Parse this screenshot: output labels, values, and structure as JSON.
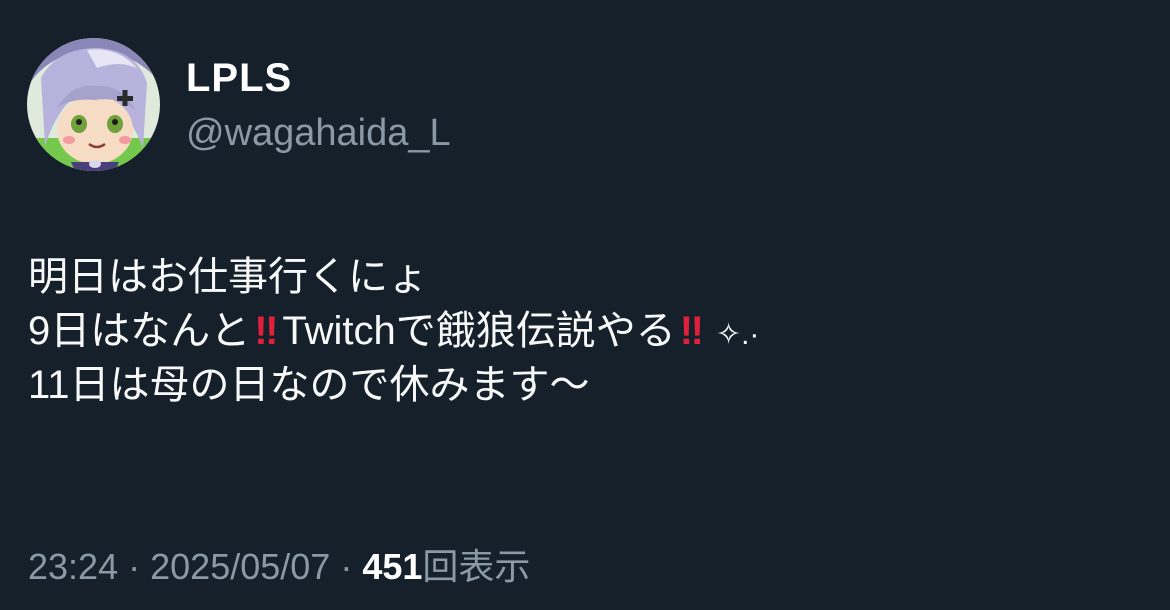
{
  "author": {
    "display_name": "LPLS",
    "handle": "@wagahaida_L",
    "avatar_icon": "anime-character-avatar"
  },
  "post": {
    "line1": "明日はお仕事行くにょ",
    "line2_prefix": "9日はなんと",
    "line2_middle": "Twitchで餓狼伝説やる",
    "emphasis": "‼",
    "emphasis_color": "#e0203a",
    "sparkle": "✧.·",
    "line3": "11日は母の日なので休みます〜"
  },
  "meta": {
    "time": "23:24",
    "separator": "·",
    "date": "2025/05/07",
    "views_count": "451",
    "views_label": "回表示"
  },
  "colors": {
    "background": "#15202b",
    "text": "#f7f9f9",
    "secondary": "#8b98a5"
  }
}
